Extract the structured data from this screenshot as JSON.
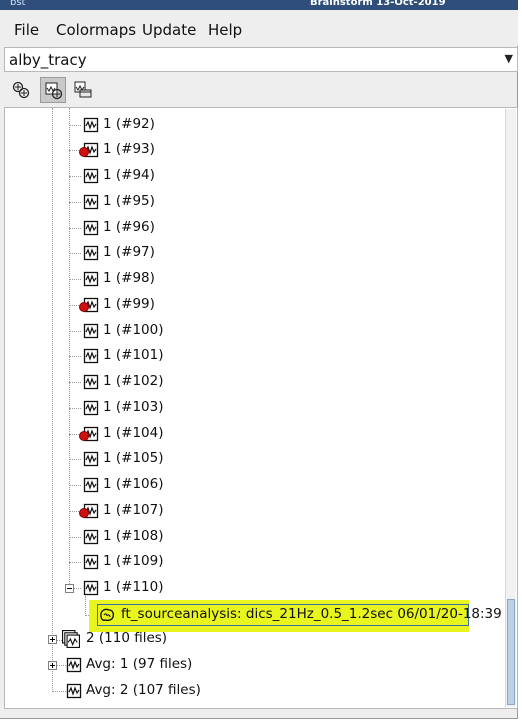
{
  "window": {
    "title": "Brainstorm 13-Oct-2019",
    "app_icon": "bst"
  },
  "menubar": {
    "items": [
      "File",
      "Colormaps",
      "Update",
      "Help"
    ]
  },
  "protocol_selector": {
    "value": "alby_tracy"
  },
  "toolbar": {
    "buttons": [
      "functional-data-view-icon",
      "anatomy-view-icon",
      "process-view-icon"
    ],
    "active": 1
  },
  "tree": {
    "rows": [
      {
        "label": "1 (#92)",
        "bad": false
      },
      {
        "label": "1 (#93)",
        "bad": true
      },
      {
        "label": "1 (#94)",
        "bad": false
      },
      {
        "label": "1 (#95)",
        "bad": false
      },
      {
        "label": "1 (#96)",
        "bad": false
      },
      {
        "label": "1 (#97)",
        "bad": false
      },
      {
        "label": "1 (#98)",
        "bad": false
      },
      {
        "label": "1 (#99)",
        "bad": true
      },
      {
        "label": "1 (#100)",
        "bad": false
      },
      {
        "label": "1 (#101)",
        "bad": false
      },
      {
        "label": "1 (#102)",
        "bad": false
      },
      {
        "label": "1 (#103)",
        "bad": false
      },
      {
        "label": "1 (#104)",
        "bad": true
      },
      {
        "label": "1 (#105)",
        "bad": false
      },
      {
        "label": "1 (#106)",
        "bad": false
      },
      {
        "label": "1 (#107)",
        "bad": true
      },
      {
        "label": "1 (#108)",
        "bad": false
      },
      {
        "label": "1 (#109)",
        "bad": false
      },
      {
        "label": "1 (#110)",
        "bad": false
      }
    ],
    "source_file": "ft_sourceanalysis: dics_21Hz_0.5_1.2sec 06/01/20-18:39",
    "groups": [
      {
        "label": "2 (110 files)",
        "icon": "trial-group-icon"
      },
      {
        "label": "Avg: 1 (97 files)",
        "icon": "average-data-icon"
      },
      {
        "label": "Avg: 2 (107 files)",
        "icon": "average-data-icon"
      }
    ],
    "highlight_color": "#e8f51f"
  }
}
